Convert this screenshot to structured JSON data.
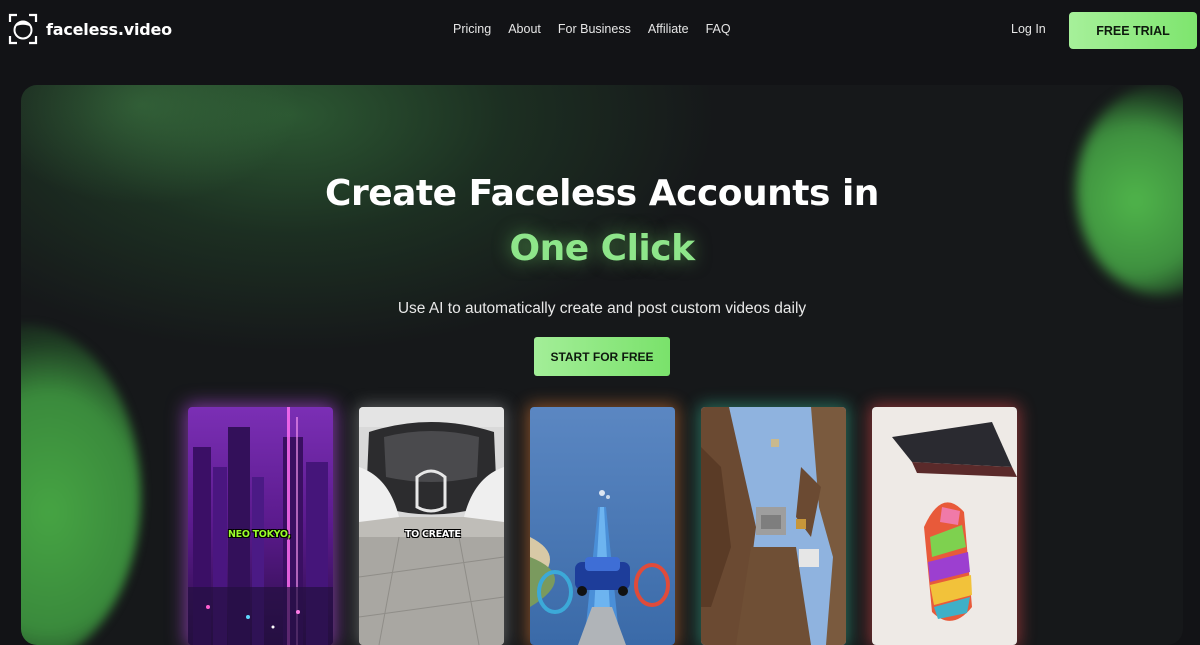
{
  "brand": {
    "name": "faceless.video"
  },
  "nav": {
    "items": [
      "Pricing",
      "About",
      "For Business",
      "Affiliate",
      "FAQ"
    ],
    "login_label": "Log In",
    "trial_label": "FREE TRIAL"
  },
  "hero": {
    "headline": "Create Faceless Accounts in",
    "headline_accent": "One Click",
    "subtitle": "Use AI to automatically create and post custom videos daily",
    "cta_label": "START FOR FREE",
    "accent_color": "#8ee58a"
  },
  "videos": [
    {
      "caption": "NEO TOKYO,",
      "theme": "neon-city"
    },
    {
      "caption": "TO CREATE",
      "theme": "sports-car"
    },
    {
      "caption": "",
      "theme": "car-race-game"
    },
    {
      "caption": "",
      "theme": "minecraft-parkour"
    },
    {
      "caption": "",
      "theme": "slicing-asmr"
    }
  ]
}
